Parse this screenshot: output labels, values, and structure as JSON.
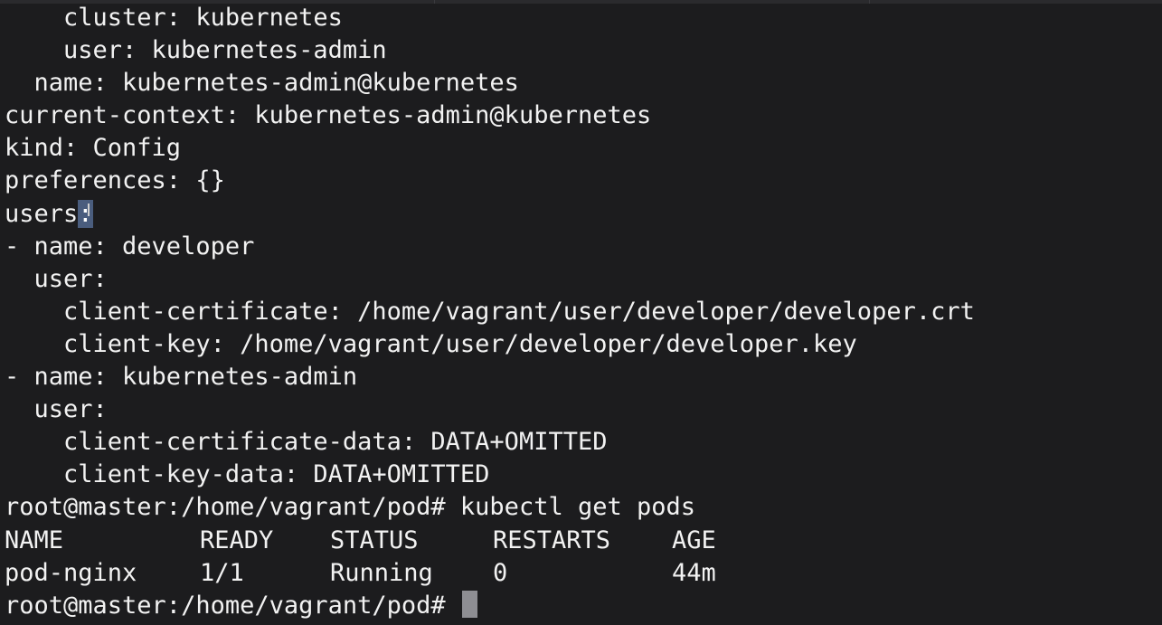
{
  "terminal": {
    "lines": [
      "    cluster: kubernetes",
      "    user: kubernetes-admin",
      "  name: kubernetes-admin@kubernetes",
      "current-context: kubernetes-admin@kubernetes",
      "kind: Config",
      "preferences: {}"
    ],
    "users_key": "users",
    "users_colon": ":",
    "lines2": [
      "- name: developer",
      "  user:",
      "    client-certificate: /home/vagrant/user/developer/developer.crt",
      "    client-key: /home/vagrant/user/developer/developer.key",
      "- name: kubernetes-admin",
      "  user:",
      "    client-certificate-data: DATA+OMITTED",
      "    client-key-data: DATA+OMITTED",
      "root@master:/home/vagrant/pod# kubectl get pods"
    ],
    "table": {
      "headers": [
        "NAME",
        "READY",
        "STATUS",
        "RESTARTS",
        "AGE"
      ],
      "rows": [
        [
          "pod-nginx",
          "1/1",
          "Running",
          "0",
          "44m"
        ]
      ]
    },
    "prompt": "root@master:/home/vagrant/pod# "
  }
}
